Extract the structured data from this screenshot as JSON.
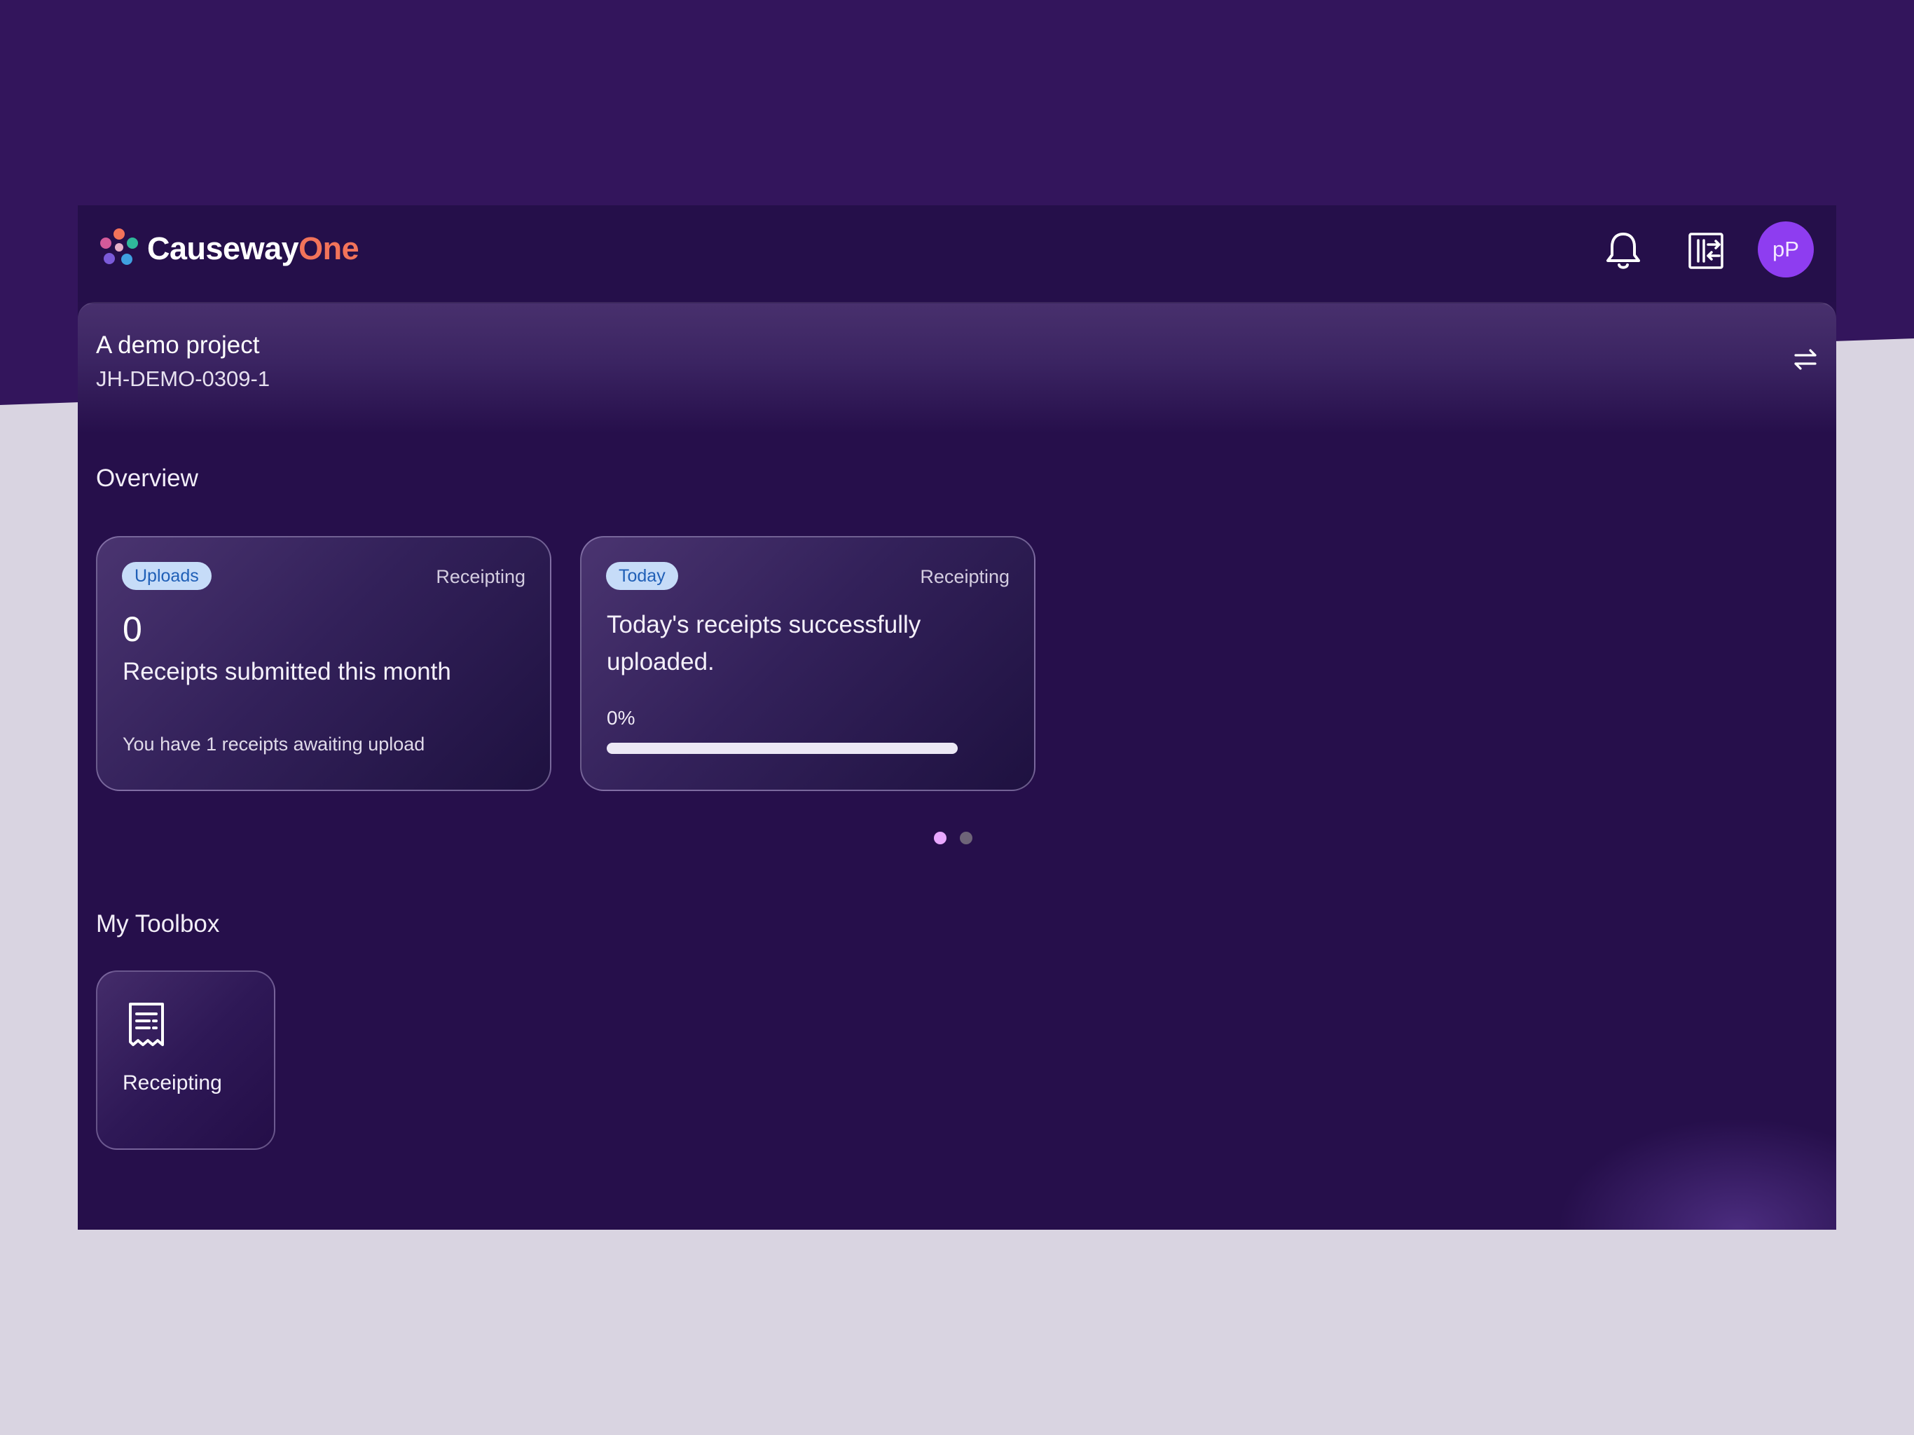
{
  "header": {
    "brand_part1": "Causeway",
    "brand_part2": "One",
    "avatar_initials": "pP",
    "icons": [
      "causeway-logo-icon",
      "bell-icon",
      "switch-app-icon",
      "swap-icon",
      "receipt-icon"
    ]
  },
  "project": {
    "name": "A demo project",
    "code": "JH-DEMO-0309-1"
  },
  "overview": {
    "title": "Overview",
    "cards": [
      {
        "tag": "Uploads",
        "category": "Receipting",
        "count": "0",
        "description": "Receipts submitted this month",
        "footer": "You have 1 receipts awaiting upload"
      },
      {
        "tag": "Today",
        "category": "Receipting",
        "description": "Today's receipts successfully uploaded.",
        "percent_label": "0%",
        "progress": 0
      }
    ],
    "pagination": {
      "pages": 2,
      "active": 0
    }
  },
  "toolbox": {
    "title": "My Toolbox",
    "items": [
      {
        "label": "Receipting"
      }
    ]
  },
  "colors": {
    "background_top": "#33155c",
    "background_bottom": "#d9d4e1",
    "app_background": "#260f4b",
    "brand_accent": "#f2735a",
    "avatar": "#8e3df0",
    "pill_bg": "#c6dcf8",
    "pill_text": "#1f5fb7",
    "active_dot": "#e9a8ff"
  }
}
